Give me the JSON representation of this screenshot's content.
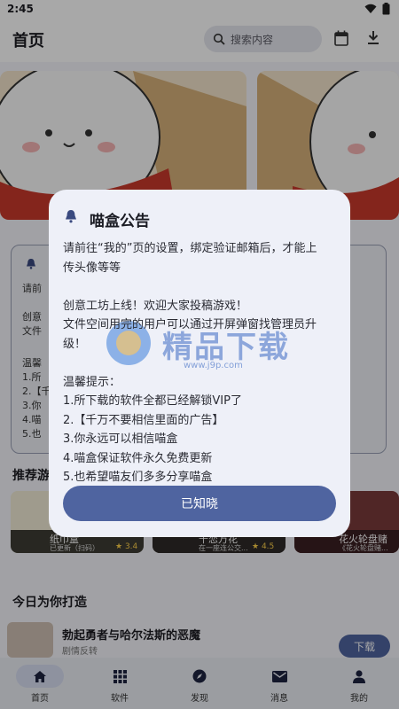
{
  "status_bar": {
    "time": "2:45"
  },
  "header": {
    "title": "首页",
    "search_placeholder": "搜索内容",
    "icons": [
      "search-icon",
      "calendar-icon",
      "download-icon"
    ]
  },
  "background": {
    "recommend_title": "推荐游",
    "today_title": "今日为你打造",
    "rec_cards": [
      {
        "title": "纸巾盒",
        "sub": "已更新（扫码）",
        "rating": "3.4"
      },
      {
        "title": "千恋万花",
        "sub": "在一座连公交...",
        "rating": "4.5"
      },
      {
        "title": "花火轮盘赌",
        "sub": "《花火轮盘赌..."
      }
    ],
    "today_item": {
      "title": "勃起勇者与哈尔法斯的恶魔",
      "sub": "剧情反转",
      "button": "下载"
    },
    "notice_preview": [
      "请前",
      "创意",
      "文件",
      "温馨",
      "1.所",
      "2.【千",
      "3.你",
      "4.喵",
      "5.也"
    ]
  },
  "bottom_nav": [
    {
      "label": "首页",
      "icon": "home-icon",
      "active": true
    },
    {
      "label": "软件",
      "icon": "apps-grid-icon",
      "active": false
    },
    {
      "label": "发现",
      "icon": "compass-icon",
      "active": false
    },
    {
      "label": "消息",
      "icon": "mail-icon",
      "active": false
    },
    {
      "label": "我的",
      "icon": "person-icon",
      "active": false
    }
  ],
  "dialog": {
    "title": "喵盒公告",
    "icon": "bell-icon",
    "body_lines": [
      "请前往“我的”页的设置，绑定验证邮箱后，才能上",
      "传头像等等",
      "",
      "创意工坊上线！欢迎大家投稿游戏！",
      "文件空间用完的用户可以通过开屏弹窗找管理员升",
      "级！",
      "",
      "温馨提示：",
      "1.所下载的软件全都已经解锁VIP了",
      "2.【千万不要相信里面的广告】",
      "3.你永远可以相信喵盒",
      "4.喵盒保证软件永久免费更新",
      "5.也希望喵友们多多分享喵盒"
    ],
    "confirm_label": "已知晓"
  },
  "watermark": {
    "text": "精品下载",
    "url": "www.j9p.com"
  },
  "colors": {
    "accent": "#4f64a0",
    "dialog_bg": "#eef0f8",
    "scrim": "rgba(0,0,0,0.34)",
    "nav_active": "#d8def2"
  }
}
